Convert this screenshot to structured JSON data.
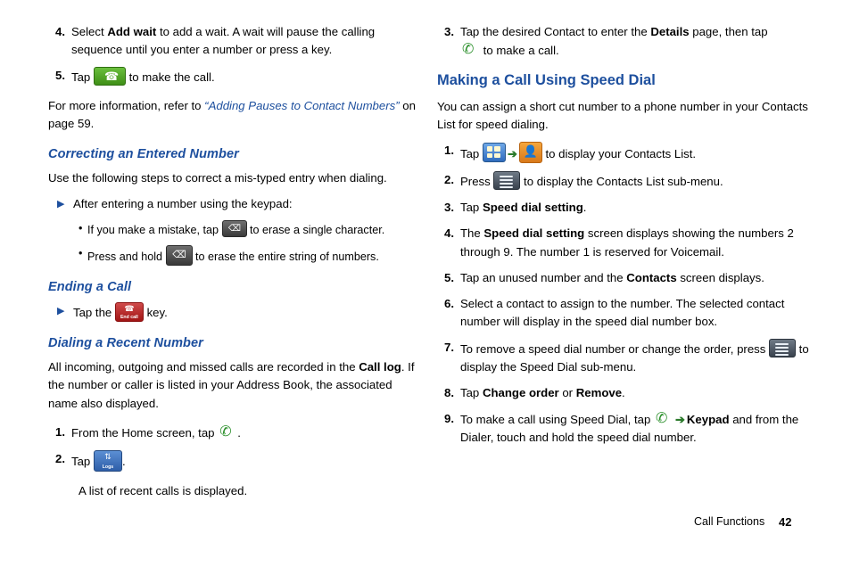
{
  "left_column": {
    "steps_top": [
      {
        "num": "4.",
        "pre": "Select ",
        "bold1": "Add wait",
        "post": " to add a wait. A wait will pause the calling sequence until you enter a number or press a key."
      },
      {
        "num": "5.",
        "pre": "Tap ",
        "icon": "call-green-button-icon",
        "post": " to make the call."
      }
    ],
    "note": {
      "pre": "For more information, refer to ",
      "quoted": "“Adding Pauses to Contact Numbers”",
      "post": " on page 59."
    },
    "heading_correcting": "Correcting an Entered Number",
    "correcting_body": "Use the following steps to correct a mis-typed entry when dialing.",
    "correcting_arrow": "After entering a number using the keypad:",
    "bullets": [
      {
        "pre": "If you make a mistake, tap ",
        "icon": "backspace-delete-icon",
        "post": " to erase a single character."
      },
      {
        "pre": "Press and hold ",
        "icon": "backspace-delete-icon",
        "post": " to erase the entire string of numbers."
      }
    ],
    "heading_ending": "Ending a Call",
    "ending_arrow": {
      "pre": "Tap the ",
      "icon": "end-call-red-button-icon",
      "post": " key."
    },
    "heading_dialing_recent": "Dialing a Recent Number",
    "recent_body": {
      "pre": "All incoming, outgoing and missed calls are recorded in the ",
      "bold1": "Call log",
      "post": ". If the number or caller is listed in your Address Book, the associated name also displayed."
    },
    "steps_recent": [
      {
        "num": "1.",
        "pre": "From the Home screen, tap ",
        "icon": "phone-dialer-icon",
        "post": "."
      },
      {
        "num": "2.",
        "pre": "Tap ",
        "bold1": "Logs",
        "icon": "logs-button-icon",
        "post": "."
      }
    ],
    "recent_result": "A list of recent calls is displayed."
  },
  "right_column": {
    "step_top": {
      "num": "3.",
      "pre": "Tap the desired Contact to enter the ",
      "bold1": "Details",
      "mid": " page, then tap ",
      "icon": "call-handset-icon",
      "post": " to make a call."
    },
    "heading_speed_dial": "Making a Call Using Speed Dial",
    "speed_dial_body": "You can assign a short cut number to a phone number in your Contacts List for speed dialing.",
    "steps": [
      {
        "num": "1.",
        "pre": "Tap ",
        "icon1": "apps-grid-icon",
        "arrow": "➔",
        "icon2": "contacts-orange-icon",
        "post": " to display your Contacts List."
      },
      {
        "num": "2.",
        "pre": "Press ",
        "icon1": "menu-key-icon",
        "post": " to display the Contacts List sub-menu."
      },
      {
        "num": "3.",
        "pre": "Tap ",
        "bold1": "Speed dial setting",
        "post": "."
      },
      {
        "num": "4.",
        "pre": "The ",
        "bold1": "Speed dial setting",
        "post": " screen displays showing the numbers 2 through 9. The number 1 is reserved for Voicemail."
      },
      {
        "num": "5.",
        "pre": "Tap an unused number and the ",
        "bold1": "Contacts",
        "post": " screen displays."
      },
      {
        "num": "6.",
        "pre": "Select a contact to assign to the number. The selected contact number will display in the speed dial number box."
      },
      {
        "num": "7.",
        "pre": "To remove a speed dial number or change the order, press ",
        "icon1": "menu-key-icon",
        "post": " to display the Speed Dial sub-menu."
      },
      {
        "num": "8.",
        "pre": "Tap ",
        "bold1": "Change order",
        "mid": " or ",
        "bold2": "Remove",
        "post": "."
      },
      {
        "num": "9.",
        "pre": "To make a call using Speed Dial, tap ",
        "icon1": "phone-dialer-icon",
        "arrow": "➔",
        "bold1": "Keypad",
        "mid": " and from the Dialer, touch and hold the speed dial number."
      }
    ]
  },
  "footer": {
    "section": "Call Functions",
    "page": "42"
  },
  "colors": {
    "heading_blue": "#1d4f9e",
    "call_green": "#4f9e23",
    "end_red": "#b01818",
    "logs_blue": "#2e5ea8",
    "contacts_orange": "#e08a24"
  }
}
